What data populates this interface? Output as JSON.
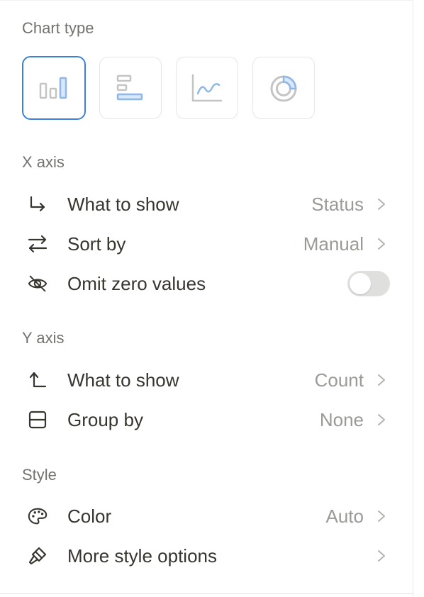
{
  "chart_type": {
    "title": "Chart type",
    "options": [
      {
        "icon": "vertical-bar-chart-icon",
        "selected": true
      },
      {
        "icon": "horizontal-bar-chart-icon",
        "selected": false
      },
      {
        "icon": "line-chart-icon",
        "selected": false
      },
      {
        "icon": "donut-chart-icon",
        "selected": false
      }
    ]
  },
  "x_axis": {
    "title": "X axis",
    "what_to_show": {
      "label": "What to show",
      "value": "Status",
      "icon": "corner-down-right-arrow-icon"
    },
    "sort_by": {
      "label": "Sort by",
      "value": "Manual",
      "icon": "swap-arrows-icon"
    },
    "omit_zero": {
      "label": "Omit zero values",
      "icon": "eye-slash-icon",
      "enabled": false
    }
  },
  "y_axis": {
    "title": "Y axis",
    "what_to_show": {
      "label": "What to show",
      "value": "Count",
      "icon": "corner-up-arrow-icon"
    },
    "group_by": {
      "label": "Group by",
      "value": "None",
      "icon": "split-square-icon"
    }
  },
  "style": {
    "title": "Style",
    "color": {
      "label": "Color",
      "value": "Auto",
      "icon": "palette-icon"
    },
    "more": {
      "label": "More style options",
      "icon": "paintbrush-icon"
    }
  },
  "colors": {
    "accent": "#3b82d6",
    "icon_blue": "#8fb7e8",
    "icon_gray": "#c4c4c2",
    "text_primary": "#37352f",
    "text_secondary": "#9b9a97",
    "section_title": "#73726e"
  }
}
